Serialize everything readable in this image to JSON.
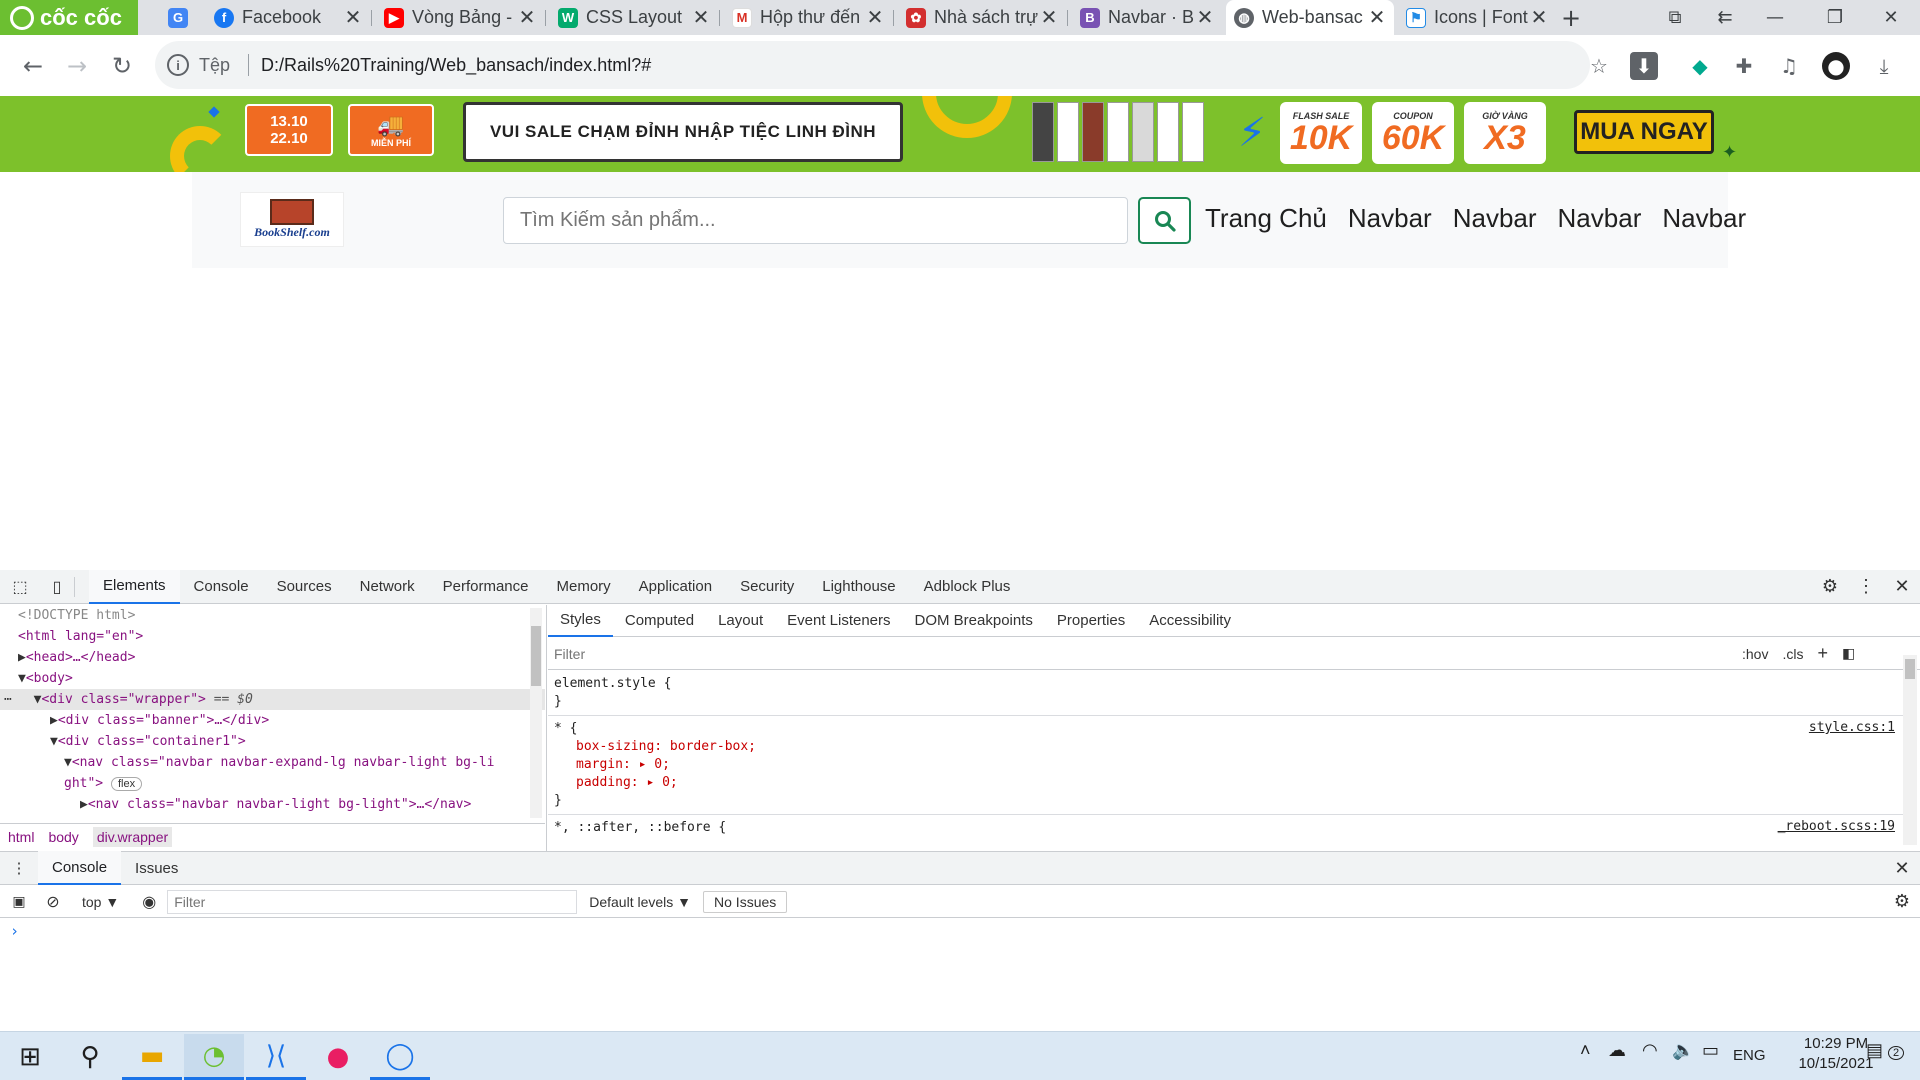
{
  "colors": {
    "accent": "#1a73e8",
    "banner_green": "#7dc12b",
    "brand_green": "#6cbf31",
    "search_button": "#198754",
    "taskbar": "#dbe8f4"
  },
  "browser": {
    "brand": "cốc cốc",
    "tabs": [
      {
        "title": "Facebook",
        "icon": "facebook-icon"
      },
      {
        "title": "Vòng Bảng -",
        "icon": "youtube-icon"
      },
      {
        "title": "CSS Layout",
        "icon": "w3schools-icon"
      },
      {
        "title": "Hộp thư đến",
        "icon": "gmail-icon"
      },
      {
        "title": "Nhà sách trự",
        "icon": "bookstore-icon"
      },
      {
        "title": "Navbar · Boo",
        "icon": "bootstrap-icon"
      },
      {
        "title": "Web-bansac",
        "icon": "globe-icon",
        "active": true
      },
      {
        "title": "Icons | Font",
        "icon": "flag-icon"
      }
    ],
    "address": {
      "scheme": "Tệp",
      "url": "D:/Rails%20Training/Web_bansach/index.html?#"
    }
  },
  "page": {
    "banner": {
      "dates": [
        "13.10",
        "22.10"
      ],
      "free_ship": "MIỄN PHÍ",
      "slogan": "VUI SALE CHẠM ĐỈNH NHẬP TIỆC LINH ĐÌNH",
      "deals": [
        {
          "caption": "FLASH SALE",
          "value": "10K"
        },
        {
          "caption": "COUPON",
          "value": "60K"
        },
        {
          "caption": "GIỜ VÀNG",
          "value": "X3"
        }
      ],
      "cta": "MUA NGAY"
    },
    "logo_text": "BookShelf.com",
    "search": {
      "placeholder": "Tìm Kiếm sản phẩm..."
    },
    "nav": [
      "Trang Chủ",
      "Navbar",
      "Navbar",
      "Navbar",
      "Navbar"
    ]
  },
  "devtools": {
    "tabs": [
      "Elements",
      "Console",
      "Sources",
      "Network",
      "Performance",
      "Memory",
      "Application",
      "Security",
      "Lighthouse",
      "Adblock Plus"
    ],
    "elements": {
      "doctype": "<!DOCTYPE html>",
      "html_open": "<html lang=\"en\">",
      "head": "<head>…</head>",
      "body": "<body>",
      "wrapper": "<div class=\"wrapper\">",
      "wrapper_marker": "== $0",
      "banner_div": "<div class=\"banner\">…</div>",
      "container": "<div class=\"container1\">",
      "nav_line1": "<nav class=\"navbar navbar-expand-lg navbar-light bg-li",
      "nav_line2": "ght\">",
      "flex_badge": "flex",
      "nav_child": "<nav class=\"navbar navbar-light bg-light\">…</nav>"
    },
    "breadcrumbs": [
      "html",
      "body",
      "div.wrapper"
    ],
    "styles_tabs": [
      "Styles",
      "Computed",
      "Layout",
      "Event Listeners",
      "DOM Breakpoints",
      "Properties",
      "Accessibility"
    ],
    "styles_filter_placeholder": "Filter",
    "hov": ":hov",
    "cls": ".cls",
    "rules": [
      {
        "selector": "element.style {",
        "close": "}"
      },
      {
        "selector": "* {",
        "source": "style.css:1",
        "props": [
          "box-sizing: border-box;",
          "margin: ▸ 0;",
          "padding: ▸ 0;"
        ],
        "close": "}"
      },
      {
        "selector": "*, ::after, ::before {",
        "source": "_reboot.scss:19"
      }
    ],
    "drawer": {
      "tabs": [
        "Console",
        "Issues"
      ],
      "context": "top ▼",
      "filter_placeholder": "Filter",
      "levels": "Default levels ▼",
      "issues": "No Issues",
      "prompt": "›"
    }
  },
  "taskbar": {
    "lang": "ENG",
    "time": "10:29 PM",
    "date": "10/15/2021",
    "notifications": "2"
  }
}
